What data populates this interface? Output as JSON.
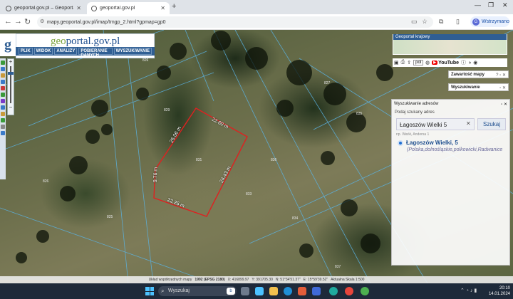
{
  "browser": {
    "tabs": [
      {
        "label": "geoportal.gov.pl – Geoportal Kra"
      },
      {
        "label": "geoportal.gov.pl"
      }
    ],
    "url": "mapy.geoportal.gov.pl/imap/Imgp_2.html?gpmap=gp0",
    "profile_label": "Wstrzymano",
    "profile_initial": "G"
  },
  "geoportal": {
    "brand_prefix": "geo",
    "brand_rest": "portal.gov.pl",
    "logo_letter": "g",
    "menu": [
      "PLIK",
      "WIDOK",
      "ANALIZY",
      "POBIERANIE DANYCH",
      "WYSZUKIWANIE"
    ]
  },
  "parcel": {
    "edges": [
      "22.60 m",
      "24.43 m",
      "22.25 m",
      "9.76 m",
      "26.06 m"
    ],
    "numbers": [
      "401",
      "826",
      "829",
      "831",
      "833",
      "834",
      "835",
      "827",
      "825",
      "826",
      "836",
      "837"
    ]
  },
  "right_panel": {
    "minimap_title": "Geoportal krajowy",
    "scale_select": "pol",
    "youtube_label": "YouTube",
    "contents_label": "Zawartość mapy",
    "search_label": "Wyszukiwanie",
    "address_search": {
      "title": "Wyszukiwanie adresów",
      "prompt": "Podaj szukany adres",
      "input_value": "Łagoszów Wielki 5",
      "button": "Szukaj",
      "hint": "np. Warki, Andersa 1",
      "result_name": "Łagoszów Wielki, 5",
      "result_path": "(Polska,dolnośląskie,polkowicki,Radwanice"
    }
  },
  "statusbar": {
    "label": "Układ współrzędnych mapy",
    "system": "1992 (EPSG 2180)",
    "x": "X: 416899.97",
    "y": "Y: 391705.30",
    "n": "N: 51°34'51.37\"",
    "e": "E: 15°59'39.52\"",
    "scale": "Aktualna Skala 1:500"
  },
  "taskbar": {
    "search_placeholder": "Wyszukaj",
    "time": "20:10",
    "date": "14.01.2024"
  }
}
